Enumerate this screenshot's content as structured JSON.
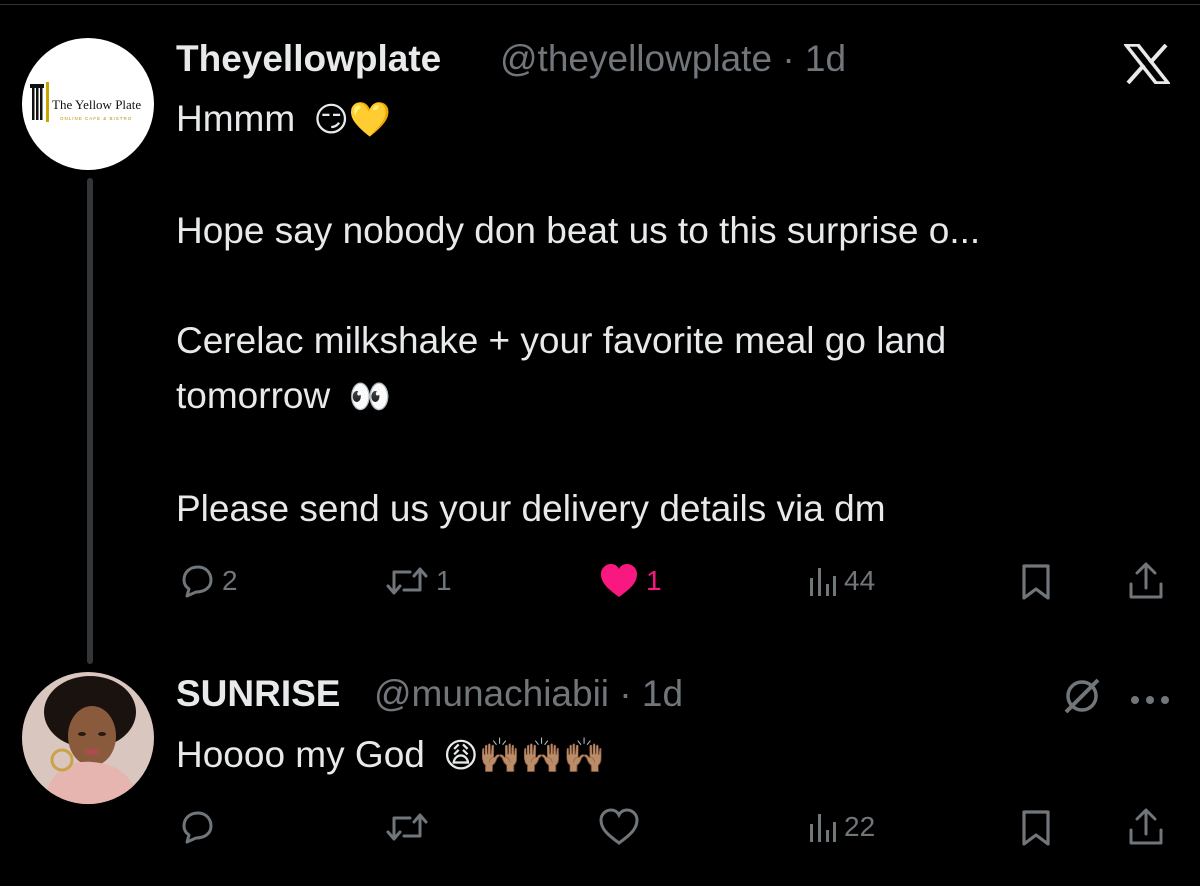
{
  "brand_color": "#f91880",
  "post": {
    "avatar_logo": {
      "line1": "The Yellow Plate",
      "line2": "ONLINE CAFE & BISTRO"
    },
    "author_name": "Theyellowplate",
    "handle_and_time": "@theyellowplate · 1d",
    "platform_icon": "x-logo-icon",
    "lines": [
      "Hmmm",
      "Hope say nobody don beat us to this surprise o...",
      "Cerelac milkshake + your favorite meal go land",
      "tomorrow",
      "Please send us your delivery details via dm"
    ],
    "emoji": {
      "hmmm": "😏💛",
      "tomorrow": "👀"
    },
    "actions": {
      "replies": "2",
      "reposts": "1",
      "likes": "1",
      "views": "44"
    },
    "liked": true
  },
  "reply": {
    "author_name": "SUNRISE",
    "handle_and_time": "@munachiabii · 1d",
    "text": "Hoooo my God",
    "emoji": "😩🙌🏽🙌🏽🙌🏽",
    "actions": {
      "views": "22"
    }
  }
}
